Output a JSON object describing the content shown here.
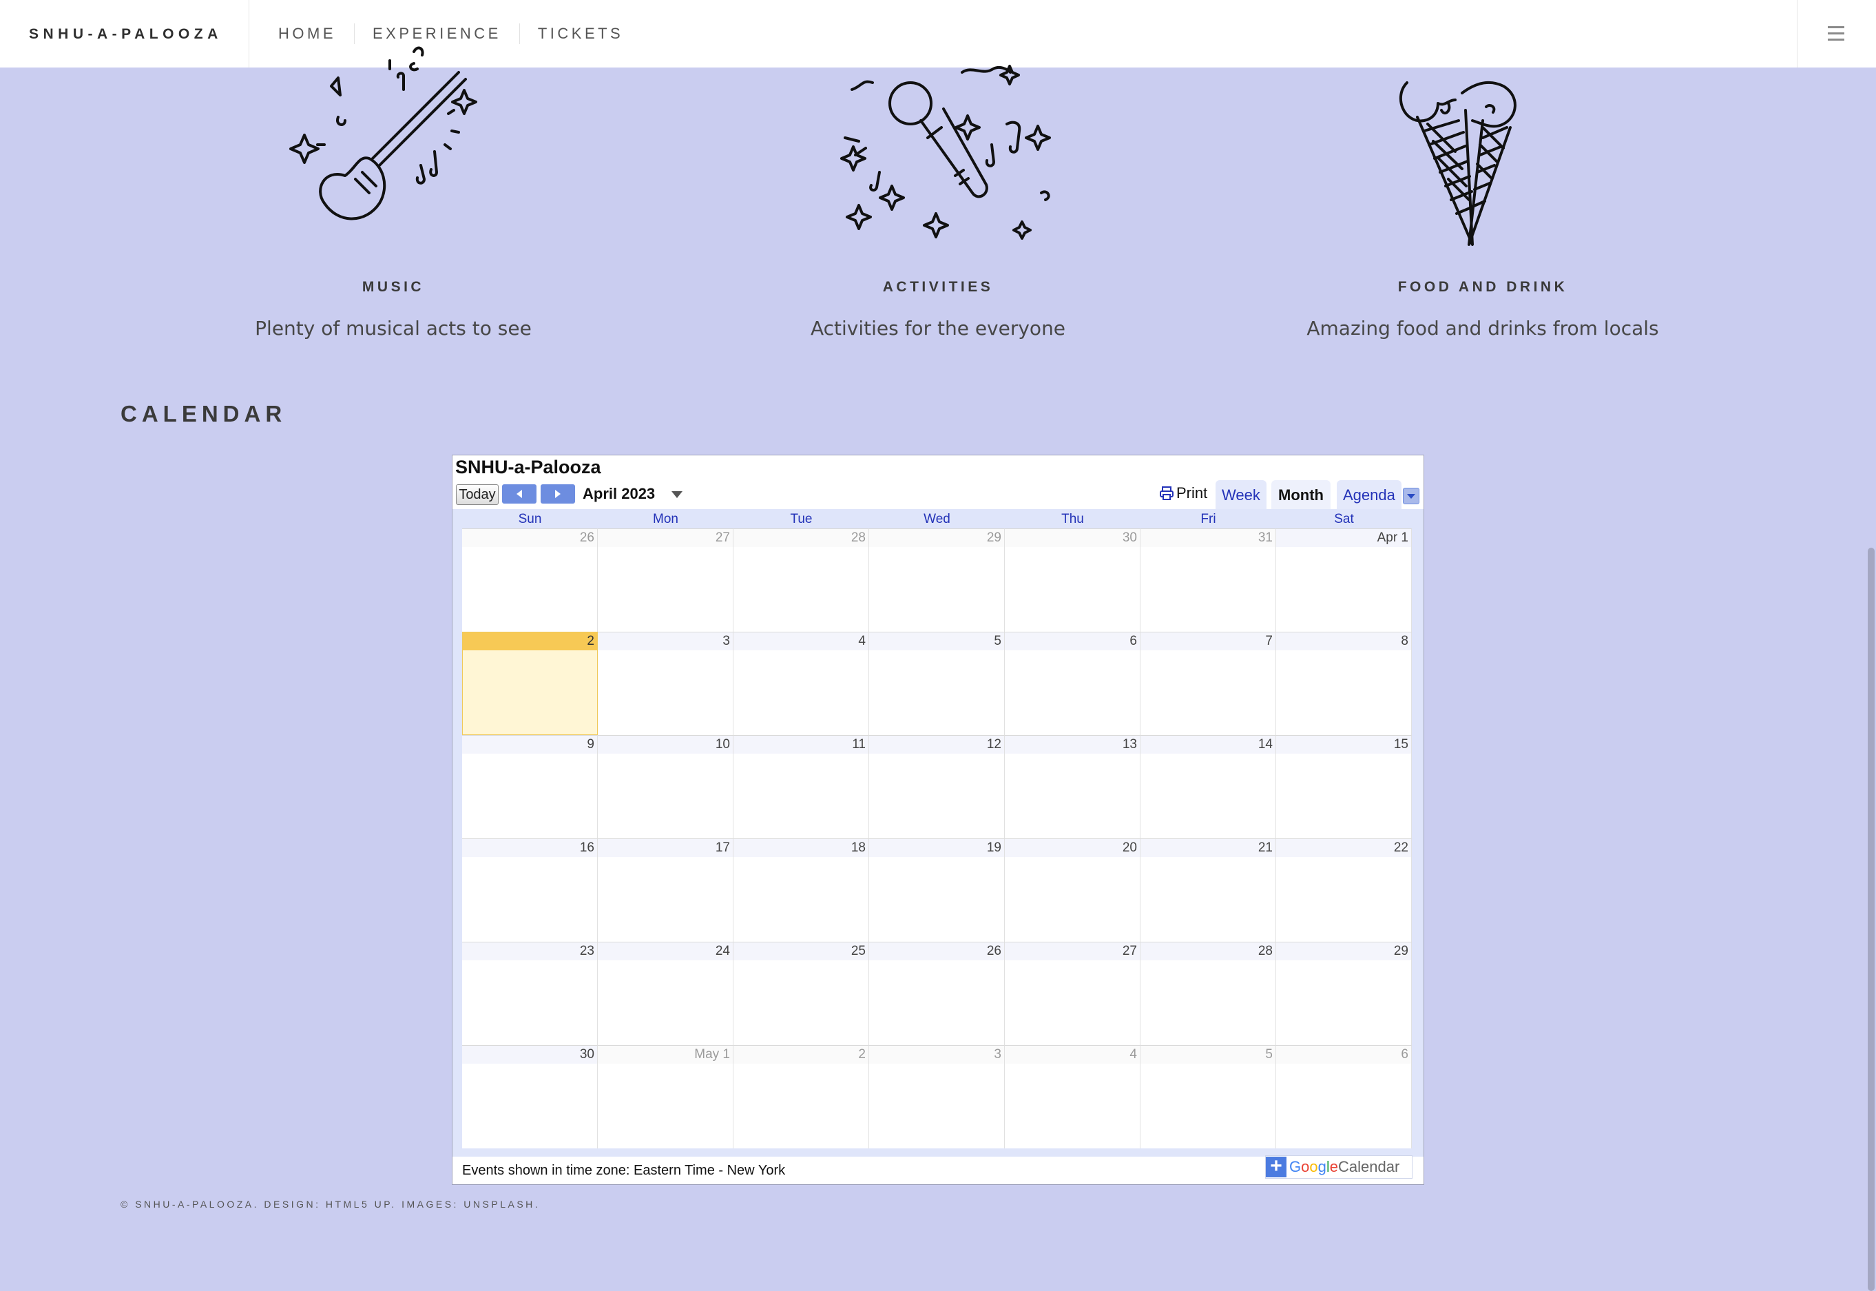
{
  "nav": {
    "brand": "SNHU-A-PALOOZA",
    "items": [
      {
        "label": "HOME"
      },
      {
        "label": "EXPERIENCE"
      },
      {
        "label": "TICKETS"
      }
    ],
    "menu_icon": "hamburger-menu-icon"
  },
  "features": [
    {
      "icon": "guitar-icon",
      "title": "MUSIC",
      "description": "Plenty of musical acts to see"
    },
    {
      "icon": "microphone-icon",
      "title": "ACTIVITIES",
      "description": "Activities for the everyone"
    },
    {
      "icon": "ice-cream-cone-icon",
      "title": "FOOD AND DRINK",
      "description": "Amazing food and drinks from locals"
    }
  ],
  "calendar_section": {
    "title": "CALENDAR"
  },
  "calendar": {
    "title": "SNHU-a-Palooza",
    "today_label": "Today",
    "month_label": "April 2023",
    "print_label": "Print",
    "views": {
      "week": "Week",
      "month": "Month",
      "agenda": "Agenda"
    },
    "weekdays": [
      "Sun",
      "Mon",
      "Tue",
      "Wed",
      "Thu",
      "Fri",
      "Sat"
    ],
    "weeks": [
      [
        "26",
        "27",
        "28",
        "29",
        "30",
        "31",
        "Apr 1"
      ],
      [
        "2",
        "3",
        "4",
        "5",
        "6",
        "7",
        "8"
      ],
      [
        "9",
        "10",
        "11",
        "12",
        "13",
        "14",
        "15"
      ],
      [
        "16",
        "17",
        "18",
        "19",
        "20",
        "21",
        "22"
      ],
      [
        "23",
        "24",
        "25",
        "26",
        "27",
        "28",
        "29"
      ],
      [
        "30",
        "May 1",
        "2",
        "3",
        "4",
        "5",
        "6"
      ]
    ],
    "timezone_note": "Events shown in time zone: Eastern Time - New York",
    "google_calendar": {
      "google": "Google",
      "calendar": "Calendar"
    },
    "colors": {
      "today_highlight": "#f7c955",
      "link": "#2433b8",
      "nav_button": "#6d8de0"
    }
  },
  "footer": {
    "text": "© SNHU-A-PALOOZA. DESIGN: HTML5 UP. IMAGES: UNSPLASH."
  },
  "theme": {
    "background": "#cacdf0"
  }
}
